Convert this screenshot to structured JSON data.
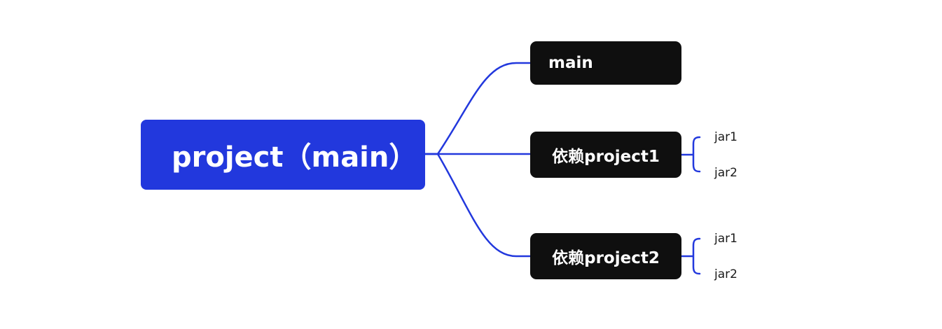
{
  "mindmap": {
    "root": {
      "label": "project（main）"
    },
    "branches": [
      {
        "label": "main",
        "children": []
      },
      {
        "label": "依赖project1",
        "children": [
          "jar1",
          "jar2"
        ]
      },
      {
        "label": "依赖project2",
        "children": [
          "jar1",
          "jar2"
        ]
      }
    ]
  },
  "colors": {
    "root_fill": "#2238dd",
    "branch_fill": "#0f0f0f",
    "connector": "#2238dd",
    "background": "#ffffff"
  }
}
